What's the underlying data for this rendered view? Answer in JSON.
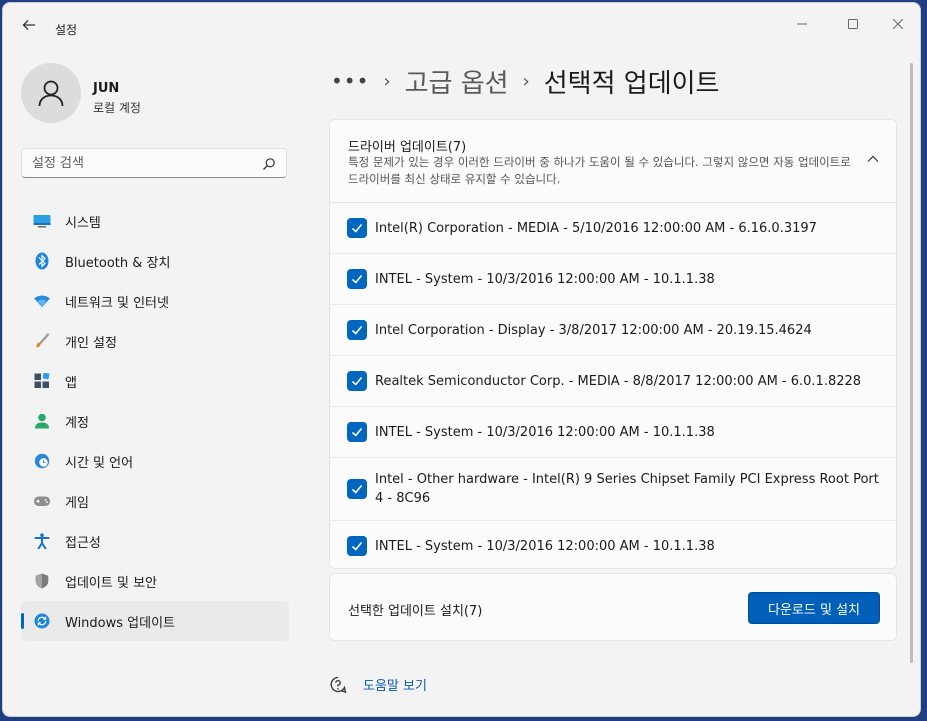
{
  "window": {
    "app_title": "설정",
    "back_icon": "arrow-left-icon"
  },
  "profile": {
    "name": "JUN",
    "account_type": "로컬 계정"
  },
  "search": {
    "placeholder": "설정 검색"
  },
  "sidebar": {
    "items": [
      {
        "label": "시스템",
        "icon": "monitor-icon",
        "active": false
      },
      {
        "label": "Bluetooth & 장치",
        "icon": "bluetooth-icon",
        "active": false
      },
      {
        "label": "네트워크 및 인터넷",
        "icon": "wifi-icon",
        "active": false
      },
      {
        "label": "개인 설정",
        "icon": "paintbrush-icon",
        "active": false
      },
      {
        "label": "앱",
        "icon": "apps-icon",
        "active": false
      },
      {
        "label": "계정",
        "icon": "person-icon",
        "active": false
      },
      {
        "label": "시간 및 언어",
        "icon": "clock-globe-icon",
        "active": false
      },
      {
        "label": "게임",
        "icon": "gamepad-icon",
        "active": false
      },
      {
        "label": "접근성",
        "icon": "accessibility-icon",
        "active": false
      },
      {
        "label": "업데이트 및 보안",
        "icon": "shield-icon",
        "active": false
      },
      {
        "label": "Windows 업데이트",
        "icon": "sync-icon",
        "active": true
      }
    ]
  },
  "breadcrumb": {
    "more": "•••",
    "parent": "고급 옵션",
    "current": "선택적 업데이트"
  },
  "drivers": {
    "title": "드라이버 업데이트(7)",
    "description": "특정 문제가 있는 경우 이러한 드라이버 중 하나가 도움이 될 수 있습니다. 그렇지 않으면 자동 업데이트로 드라이버를 최신 상태로 유지할 수 있습니다.",
    "items": [
      {
        "label": "Intel(R) Corporation - MEDIA - 5/10/2016 12:00:00 AM - 6.16.0.3197",
        "checked": true
      },
      {
        "label": "INTEL - System - 10/3/2016 12:00:00 AM - 10.1.1.38",
        "checked": true
      },
      {
        "label": "Intel Corporation - Display - 3/8/2017 12:00:00 AM - 20.19.15.4624",
        "checked": true
      },
      {
        "label": "Realtek Semiconductor Corp. - MEDIA - 8/8/2017 12:00:00 AM - 6.0.1.8228",
        "checked": true
      },
      {
        "label": "INTEL - System - 10/3/2016 12:00:00 AM - 10.1.1.38",
        "checked": true
      },
      {
        "label": "Intel - Other hardware - Intel(R) 9 Series Chipset Family PCI Express Root Port 4 - 8C96",
        "checked": true
      },
      {
        "label": "INTEL - System - 10/3/2016 12:00:00 AM - 10.1.1.38",
        "checked": true
      }
    ]
  },
  "install": {
    "label": "선택한 업데이트 설치(7)",
    "button": "다운로드 및 설치"
  },
  "help": {
    "label": "도움말 보기"
  },
  "colors": {
    "accent": "#0067c0",
    "link": "#0b5cad",
    "background": "#f3f3f3"
  }
}
